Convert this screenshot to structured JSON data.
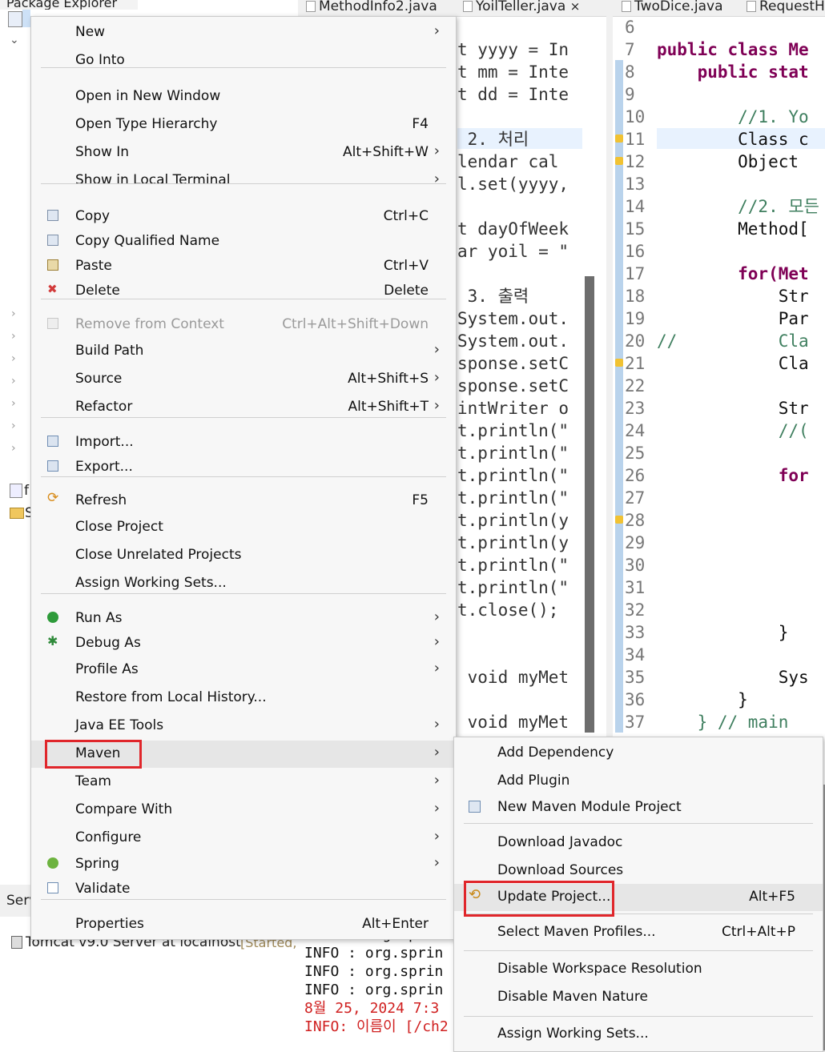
{
  "package_explorer": {
    "tab_label": "Package Explorer",
    "project_items": [
      "f",
      "S"
    ]
  },
  "editor_tabs": [
    {
      "label": "MethodInfo2.java"
    },
    {
      "label": "YoilTeller.java",
      "close": "×"
    },
    {
      "label": "TwoDice.java"
    },
    {
      "label": "RequestH"
    }
  ],
  "editor_left_lines": [
    "t yyyy = In",
    "t mm = Inte",
    "t dd = Inte",
    "",
    " 2. 처리",
    "lendar cal",
    "l.set(yyyy,",
    "",
    "t dayOfWeek",
    "ar yoil = \"",
    "",
    " 3. 출력",
    "System.out.",
    "System.out.",
    "sponse.setC",
    "sponse.setC",
    "intWriter o",
    "t.println(\"",
    "t.println(\"",
    "t.println(\"",
    "t.println(\"",
    "t.println(y",
    "t.println(y",
    "t.println(\"",
    "t.println(\"",
    "t.close();",
    "",
    "",
    " void myMet",
    "",
    " void myMet"
  ],
  "editor_right_line_numbers": [
    "6",
    "7",
    "8",
    "9",
    "10",
    "11",
    "12",
    "13",
    "14",
    "15",
    "16",
    "17",
    "18",
    "19",
    "20",
    "21",
    "22",
    "23",
    "24",
    "25",
    "26",
    "27",
    "28",
    "29",
    "30",
    "31",
    "32",
    "33",
    "34",
    "35",
    "36",
    "37"
  ],
  "editor_right_lines": [
    "",
    "public class Me",
    "    public stat",
    "",
    "        //1. Yo",
    "        Class c",
    "        Object ",
    "",
    "        //2. 모든",
    "        Method[",
    "",
    "        for(Met",
    "            Str",
    "            Par",
    "//          Cla",
    "            Cla",
    "",
    "            Str",
    "            //(",
    "",
    "            for",
    "",
    "",
    "",
    "",
    "",
    "",
    "            }",
    "",
    "            Sys",
    "        }",
    "    } // main"
  ],
  "servers_tab": {
    "label": "Serv",
    "server_entry": "Tomcat v9.0 Server at localhost",
    "server_status": "[Started,"
  },
  "console_lines": [
    {
      "text": "INFO : org.sprin",
      "color": "#111111"
    },
    {
      "text": "INFO : org.sprin",
      "color": "#111111"
    },
    {
      "text": "INFO : org.sprin",
      "color": "#111111"
    },
    {
      "text": "INFO : org.sprin",
      "color": "#111111"
    },
    {
      "text": "8월 25, 2024 7:3",
      "color": "#d02020"
    },
    {
      "text": "INFO: 이름이 [/ch2",
      "color": "#d02020"
    }
  ],
  "context_menu": {
    "items": [
      {
        "label": "New",
        "accel": "",
        "submenu": true,
        "icon": ""
      },
      {
        "label": "Go Into",
        "accel": "",
        "submenu": false,
        "icon": ""
      },
      {
        "label": "Open in New Window",
        "accel": "",
        "submenu": false,
        "icon": ""
      },
      {
        "label": "Open Type Hierarchy",
        "accel": "F4",
        "submenu": false,
        "icon": ""
      },
      {
        "label": "Show In",
        "accel": "Alt+Shift+W",
        "submenu": true,
        "icon": ""
      },
      {
        "label": "Show in Local Terminal",
        "accel": "",
        "submenu": true,
        "icon": ""
      },
      {
        "label": "Copy",
        "accel": "Ctrl+C",
        "submenu": false,
        "icon": "copy-icon"
      },
      {
        "label": "Copy Qualified Name",
        "accel": "",
        "submenu": false,
        "icon": "copy-qualified-icon"
      },
      {
        "label": "Paste",
        "accel": "Ctrl+V",
        "submenu": false,
        "icon": "paste-icon"
      },
      {
        "label": "Delete",
        "accel": "Delete",
        "submenu": false,
        "icon": "delete-icon"
      },
      {
        "label": "Remove from Context",
        "accel": "Ctrl+Alt+Shift+Down",
        "submenu": false,
        "icon": "remove-context-icon",
        "disabled": true
      },
      {
        "label": "Build Path",
        "accel": "",
        "submenu": true,
        "icon": ""
      },
      {
        "label": "Source",
        "accel": "Alt+Shift+S",
        "submenu": true,
        "icon": ""
      },
      {
        "label": "Refactor",
        "accel": "Alt+Shift+T",
        "submenu": true,
        "icon": ""
      },
      {
        "label": "Import...",
        "accel": "",
        "submenu": false,
        "icon": "import-icon"
      },
      {
        "label": "Export...",
        "accel": "",
        "submenu": false,
        "icon": "export-icon"
      },
      {
        "label": "Refresh",
        "accel": "F5",
        "submenu": false,
        "icon": "refresh-icon"
      },
      {
        "label": "Close Project",
        "accel": "",
        "submenu": false,
        "icon": ""
      },
      {
        "label": "Close Unrelated Projects",
        "accel": "",
        "submenu": false,
        "icon": ""
      },
      {
        "label": "Assign Working Sets...",
        "accel": "",
        "submenu": false,
        "icon": ""
      },
      {
        "label": "Run As",
        "accel": "",
        "submenu": true,
        "icon": "run-icon"
      },
      {
        "label": "Debug As",
        "accel": "",
        "submenu": true,
        "icon": "debug-icon"
      },
      {
        "label": "Profile As",
        "accel": "",
        "submenu": true,
        "icon": ""
      },
      {
        "label": "Restore from Local History...",
        "accel": "",
        "submenu": false,
        "icon": ""
      },
      {
        "label": "Java EE Tools",
        "accel": "",
        "submenu": true,
        "icon": ""
      },
      {
        "label": "Maven",
        "accel": "",
        "submenu": true,
        "icon": "",
        "highlighted": true
      },
      {
        "label": "Team",
        "accel": "",
        "submenu": true,
        "icon": ""
      },
      {
        "label": "Compare With",
        "accel": "",
        "submenu": true,
        "icon": ""
      },
      {
        "label": "Configure",
        "accel": "",
        "submenu": true,
        "icon": ""
      },
      {
        "label": "Spring",
        "accel": "",
        "submenu": true,
        "icon": "spring-icon"
      },
      {
        "label": "Validate",
        "accel": "",
        "submenu": false,
        "icon": "validate-icon"
      },
      {
        "label": "Properties",
        "accel": "Alt+Enter",
        "submenu": false,
        "icon": ""
      }
    ],
    "submenu_glyph": "›"
  },
  "maven_submenu": {
    "items": [
      {
        "label": "Add Dependency",
        "accel": "",
        "icon": ""
      },
      {
        "label": "Add Plugin",
        "accel": "",
        "icon": ""
      },
      {
        "label": "New Maven Module Project",
        "accel": "",
        "icon": "maven-module-icon"
      },
      {
        "label": "Download Javadoc",
        "accel": "",
        "icon": ""
      },
      {
        "label": "Download Sources",
        "accel": "",
        "icon": ""
      },
      {
        "label": "Update Project...",
        "accel": "Alt+F5",
        "icon": "update-project-icon",
        "highlighted": true
      },
      {
        "label": "Select Maven Profiles...",
        "accel": "Ctrl+Alt+P",
        "icon": ""
      },
      {
        "label": "Disable Workspace Resolution",
        "accel": "",
        "icon": ""
      },
      {
        "label": "Disable Maven Nature",
        "accel": "",
        "icon": ""
      },
      {
        "label": "Assign Working Sets...",
        "accel": "",
        "icon": ""
      }
    ]
  },
  "colors": {
    "highlight_box": "#e0262b",
    "menu_bg": "#f7f7f7",
    "keyword": "#7f0055",
    "comment": "#3f7f5f"
  }
}
